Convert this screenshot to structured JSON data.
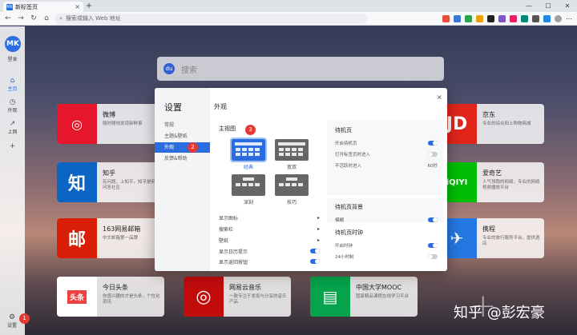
{
  "browser": {
    "tab_title": "新标签页",
    "tab_favicon": "MK",
    "new_tab": "+",
    "address_placeholder": "搜索或输入 Web 地址"
  },
  "sidebar": {
    "logo": "MK",
    "logo_label": "登录",
    "items": [
      {
        "icon": "home-icon",
        "glyph": "⌂",
        "label": "主页"
      },
      {
        "icon": "clock-icon",
        "glyph": "◷",
        "label": "外观"
      },
      {
        "icon": "arrow-icon",
        "glyph": "↗",
        "label": "上网"
      },
      {
        "icon": "plus-icon",
        "glyph": "+",
        "label": ""
      }
    ],
    "settings_label": "设置",
    "settings_badge": "1"
  },
  "search": {
    "placeholder": "搜索"
  },
  "cards": [
    {
      "title": "微博",
      "desc": "随时随地发现新鲜事",
      "icon_text": "◎",
      "color": "#e6162d"
    },
    {
      "title": "知乎",
      "desc": "有问题，上知乎。知乎是网络问答社区",
      "icon_text": "知",
      "color": "#0a66c2"
    },
    {
      "title": "163网易邮箱",
      "desc": "中文邮箱第一品牌",
      "icon_text": "邮",
      "color": "#d81e06"
    },
    {
      "title": "今日头条",
      "desc": "你感兴趣的才是头条，个性化资讯",
      "icon_text": "头条",
      "color": "#ed4040"
    },
    {
      "title": "网易云音乐",
      "desc": "一款专注于发现与分享的音乐产品",
      "icon_text": "◎",
      "color": "#c20c0c"
    },
    {
      "title": "中国大学MOOC",
      "desc": "国家精品课程在线学习平台",
      "icon_text": "▤",
      "color": "#05a34b"
    },
    {
      "title": "京东",
      "desc": "专业的综合网上购物商城",
      "icon_text": "JD",
      "color": "#e1251b"
    },
    {
      "title": "爱奇艺",
      "desc": "人气领跑的网络，专业的网络视频播放平台",
      "icon_text": "iQIYI",
      "color": "#00be06"
    },
    {
      "title": "携程",
      "desc": "专业的旅行服务平台，提供酒店",
      "icon_text": "✈",
      "color": "#2577e3"
    }
  ],
  "modal": {
    "title": "设置",
    "header": "外观",
    "close": "×",
    "menu": [
      "常规",
      "主题&壁纸",
      "外观",
      "反馈&帮助"
    ],
    "active_index": 2,
    "badge_menu": "2",
    "badge_theme": "3",
    "main_view_label": "主视图",
    "themes": [
      "经典",
      "宽双",
      "深刻",
      "技巧"
    ],
    "selected_theme": 0,
    "list_rows": [
      "显示图标",
      "搜索栏",
      "壁纸",
      "显示日历提示",
      "显示返回按钮"
    ],
    "panel1": {
      "title": "待机页",
      "rows": [
        {
          "label": "开启待机页",
          "toggle": true
        },
        {
          "label": "打开标签页时进入",
          "toggle": false
        },
        {
          "label": "不活跃时进入",
          "value": "60秒"
        }
      ]
    },
    "panel2": {
      "title": "待机页背景",
      "rows": [
        {
          "label": "模糊",
          "toggle": true
        }
      ]
    },
    "panel3": {
      "title": "待机页时钟",
      "rows": [
        {
          "label": "开启时钟",
          "toggle": true
        },
        {
          "label": "24小时制",
          "toggle": false
        }
      ]
    }
  },
  "watermark": "知乎 @彭宏豪",
  "add_tile": "+"
}
